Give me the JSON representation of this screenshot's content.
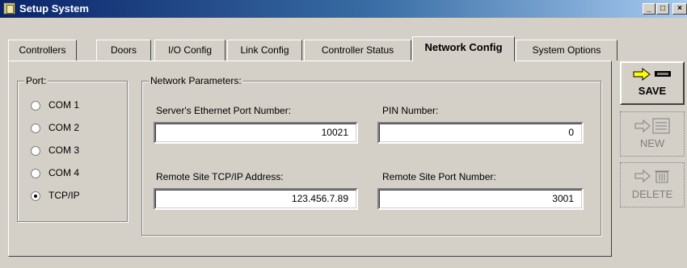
{
  "window": {
    "title": "Setup System",
    "controls": [
      "minimize",
      "maximize",
      "close"
    ]
  },
  "tabs": [
    {
      "label": "Controllers",
      "active": false
    },
    {
      "label": "Doors",
      "active": false
    },
    {
      "label": "I/O Config",
      "active": false
    },
    {
      "label": "Link Config",
      "active": false
    },
    {
      "label": "Controller Status",
      "active": false
    },
    {
      "label": "Network Config",
      "active": true
    },
    {
      "label": "System Options",
      "active": false
    }
  ],
  "port": {
    "title": "Port:",
    "options": [
      {
        "label": "COM 1",
        "selected": false
      },
      {
        "label": "COM 2",
        "selected": false
      },
      {
        "label": "COM 3",
        "selected": false
      },
      {
        "label": "COM 4",
        "selected": false
      },
      {
        "label": "TCP/IP",
        "selected": true
      }
    ]
  },
  "network": {
    "title": "Network Parameters:",
    "ethernet_port_label": "Server's Ethernet Port Number:",
    "ethernet_port_value": "10021",
    "pin_label": "PIN Number:",
    "pin_value": "0",
    "remote_address_label": "Remote Site TCP/IP Address:",
    "remote_address_value": "123.456.7.89",
    "remote_port_label": "Remote Site Port Number:",
    "remote_port_value": "3001"
  },
  "actions": {
    "save": "SAVE",
    "new": "NEW",
    "delete": "DELETE"
  },
  "colors": {
    "titlebar_start": "#0a246a",
    "titlebar_end": "#a6caf0",
    "face": "#d4d0c8",
    "arrow_yellow": "#ffff00"
  }
}
